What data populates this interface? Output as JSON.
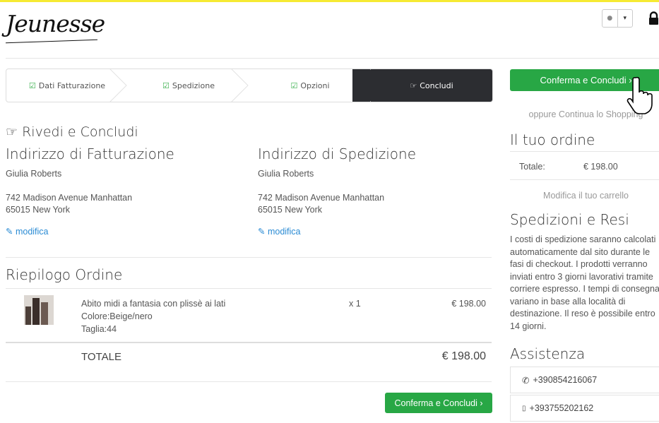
{
  "brand": {
    "logo_text": "Jeunesse"
  },
  "steps": [
    {
      "label": "Dati Fatturazione",
      "icon": "check-square-icon",
      "active": false
    },
    {
      "label": "Spedizione",
      "icon": "check-square-icon",
      "active": false
    },
    {
      "label": "Opzioni",
      "icon": "check-square-icon",
      "active": false
    },
    {
      "label": "Concludi",
      "icon": "hand-point-right-icon",
      "active": true
    }
  ],
  "review": {
    "title": "Rivedi e Concludi",
    "billing": {
      "heading": "Indirizzo di Fatturazione",
      "name": "Giulia Roberts",
      "street": "742 Madison Avenue Manhattan",
      "city": "65015 New York",
      "edit": "modifica"
    },
    "shipping": {
      "heading": "Indirizzo di Spedizione",
      "name": "Giulia Roberts",
      "street": "742 Madison Avenue Manhattan",
      "city": "65015 New York",
      "edit": "modifica"
    }
  },
  "order": {
    "heading": "Riepilogo Ordine",
    "items": [
      {
        "name": "Abito midi a fantasia con plissè ai lati",
        "color": "Colore:Beige/nero",
        "size": "Taglia:44",
        "qty": "x 1",
        "price": "€ 198.00"
      }
    ],
    "total_label": "TOTALE",
    "total_value": "€ 198.00",
    "confirm_label": "Conferma e Concludi ›"
  },
  "sidebar": {
    "confirm_label": "Conferma e Concludi ›",
    "continue_label": "oppure Continua lo Shopping",
    "your_order": "Il tuo ordine",
    "total_label": "Totale:",
    "total_value": "€ 198.00",
    "edit_cart": "Modifica il tuo carrello",
    "shipping_heading": "Spedizioni e Resi",
    "shipping_text": "I costi di spedizione saranno calcolati automaticamente dal sito durante le fasi di checkout. I prodotti verranno inviati entro 3 giorni lavorativi tramite corriere espresso. I tempi di consegna variano in base alla località di destinazione. Il reso è possibile entro 14 giorni.",
    "assist_heading": "Assistenza",
    "phone": "+390854216067",
    "mobile": "+393755202162"
  },
  "colors": {
    "accent_green": "#28a745",
    "link_blue": "#2a8bd4",
    "dark_step": "#2c2d31"
  }
}
